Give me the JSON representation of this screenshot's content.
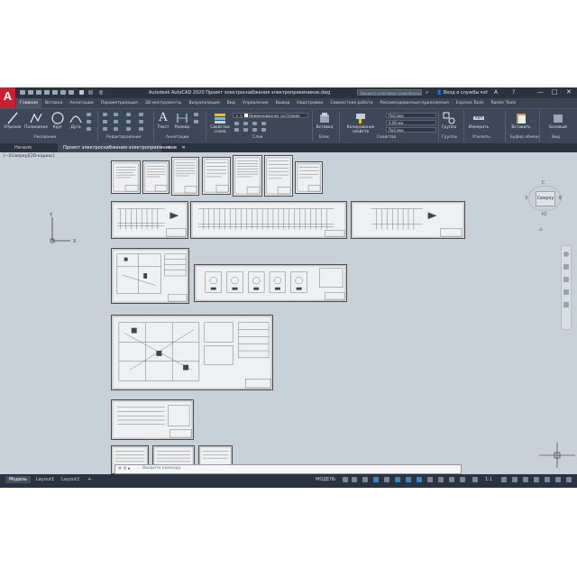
{
  "app": {
    "logo_letter": "A",
    "title": "Autodesk AutoCAD 2020   Проект электроснабжения электроприемников.dwg",
    "search_placeholder": "Введите ключевое слово/фразу",
    "user": "Вход в службы",
    "minimize": "—",
    "maximize": "□",
    "close": "✕"
  },
  "ribbon_tabs": [
    "Главная",
    "Вставка",
    "Аннотации",
    "Параметризация",
    "3D-инструменты",
    "Визуализация",
    "Вид",
    "Управление",
    "Вывод",
    "Надстройки",
    "Совместная работа",
    "Рекомендованные приложения",
    "Express Tools",
    "Raster Tools"
  ],
  "ribbon": {
    "tools": {
      "line": "Отрезок",
      "polyline": "Полилиния",
      "circle": "Круг",
      "arc": "Дуга",
      "text": "Текст",
      "dimension": "Размер",
      "layer_properties": "Свойства\nслоев",
      "insert": "Вставка",
      "match_properties": "Копирование\nсвойств",
      "group": "Группа",
      "measure": "Измерить",
      "paste": "Вставить",
      "base": "Базовый"
    },
    "panels": {
      "draw": "Рисование",
      "modify": "Редактирование",
      "annotation": "Аннотации",
      "layers": "Слои",
      "block": "Блок",
      "properties": "Свойства",
      "groups": "Группы",
      "utilities": "Утилиты",
      "clipboard": "Буфер обмена",
      "view": "Вид"
    },
    "combos": {
      "layer_state": "Неименованное состояние",
      "color": "ПоСлою",
      "lineweight": "0.00 мм",
      "linetype": "ПоСлою"
    }
  },
  "doc_tabs": {
    "start": "Начало",
    "project": "Проект электроснабжения электроприемников",
    "close": "✕",
    "add": "+"
  },
  "canvas": {
    "view_label": "[−][Сверху][2D-каркас]",
    "ucs_x": "X",
    "ucs_y": "Y",
    "viewcube_face": "Сверху",
    "viewcube_n": "С",
    "viewcube_s": "Ю",
    "viewcube_w": "З",
    "viewcube_e": "В"
  },
  "command_line": {
    "prompt": "Введите команду"
  },
  "status_bar": {
    "layout_tabs": [
      "Модель",
      "Layout1",
      "Layout2"
    ],
    "add": "+",
    "model": "МОДЕЛЬ",
    "scale": "1:1"
  }
}
